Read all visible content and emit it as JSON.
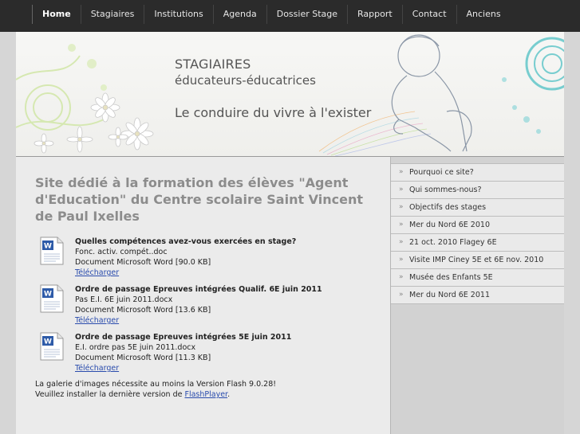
{
  "nav": {
    "items": [
      {
        "label": "Home",
        "active": true
      },
      {
        "label": "Stagiaires",
        "active": false
      },
      {
        "label": "Institutions",
        "active": false
      },
      {
        "label": "Agenda",
        "active": false
      },
      {
        "label": "Dossier Stage",
        "active": false
      },
      {
        "label": "Rapport",
        "active": false
      },
      {
        "label": "Contact",
        "active": false
      },
      {
        "label": "Anciens",
        "active": false
      }
    ]
  },
  "header": {
    "line1": "STAGIAIRES",
    "line2": "éducateurs-éducatrices",
    "tagline": "Le conduire du vivre à l'exister"
  },
  "main": {
    "headline": "Site dédié à la formation des élèves \"Agent d'Education\" du Centre scolaire Saint Vincent de Paul Ixelles",
    "documents": [
      {
        "title": "Quelles compétences avez-vous exercées en stage?",
        "filename": "Fonc. activ. compét..doc",
        "info": "Document Microsoft Word [90.0 KB]",
        "download": "Télécharger"
      },
      {
        "title": "Ordre de passage Epreuves intégrées Qualif. 6E juin 2011",
        "filename": "Pas E.I. 6E juin 2011.docx",
        "info": "Document Microsoft Word [13.6 KB]",
        "download": "Télécharger"
      },
      {
        "title": "Ordre de passage Epreuves intégrées 5E juin 2011",
        "filename": "E.I. ordre pas 5E juin 2011.docx",
        "info": "Document Microsoft Word [11.3 KB]",
        "download": "Télécharger"
      }
    ],
    "flash_line1": "La galerie d'images nécessite au moins la Version Flash 9.0.28!",
    "flash_line2_prefix": "Veuillez installer la dernière version de ",
    "flash_link": "FlashPlayer",
    "flash_line2_suffix": "."
  },
  "sidebar": {
    "arrow_glyph": "»",
    "items": [
      "Pourquoi ce site?",
      "Qui sommes-nous?",
      "Objectifs des stages",
      "Mer du Nord 6E 2010",
      "21 oct. 2010 Flagey 6E",
      "Visite IMP Ciney 5E et 6E nov. 2010",
      "Musée des Enfants 5E",
      "Mer du Nord 6E 2011"
    ]
  },
  "icons": {
    "document": "word-document-icon"
  },
  "colors": {
    "nav_bg": "#2b2b2b",
    "headline": "#8c8c8c",
    "link": "#2a4cad"
  }
}
